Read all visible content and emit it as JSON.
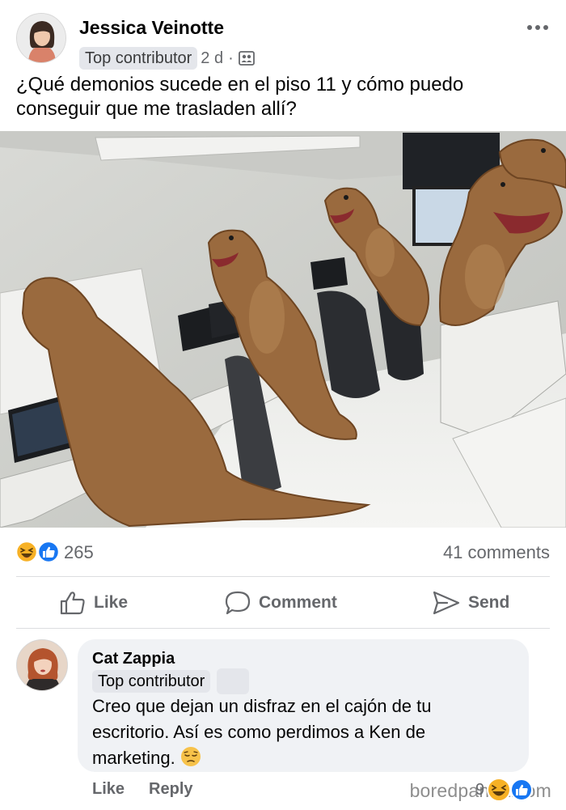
{
  "post": {
    "author": "Jessica Veinotte",
    "badge": "Top contributor",
    "time": "2 d",
    "separator": "·",
    "text": "¿Qué demonios sucede en el piso 11 y cómo puedo conseguir que me trasladen allí?",
    "icons": {
      "avatar": "profile-photo",
      "audience": "group-icon",
      "more": "more-options-icon"
    }
  },
  "engagement": {
    "reaction_count": "265",
    "comments_label": "41 comments",
    "reaction_icons": [
      "laughing-face-icon",
      "thumbs-up-icon"
    ]
  },
  "actions": {
    "like_label": "Like",
    "comment_label": "Comment",
    "send_label": "Send"
  },
  "comment": {
    "author": "Cat Zappia",
    "badge": "Top contributor",
    "text": "Creo que dejan un disfraz en el cajón de tu escritorio. Así es como perdimos a Ken de marketing.",
    "emoji": "😔",
    "like_label": "Like",
    "reply_label": "Reply",
    "reaction_count": "9"
  },
  "watermark": "boredpanda.com",
  "colors": {
    "text_primary": "#050505",
    "text_secondary": "#65676b",
    "badge_bg": "#e4e6eb",
    "bubble_bg": "#f0f2f5",
    "like_blue": "#1877f2",
    "haha_yellow": "#f7b125"
  }
}
